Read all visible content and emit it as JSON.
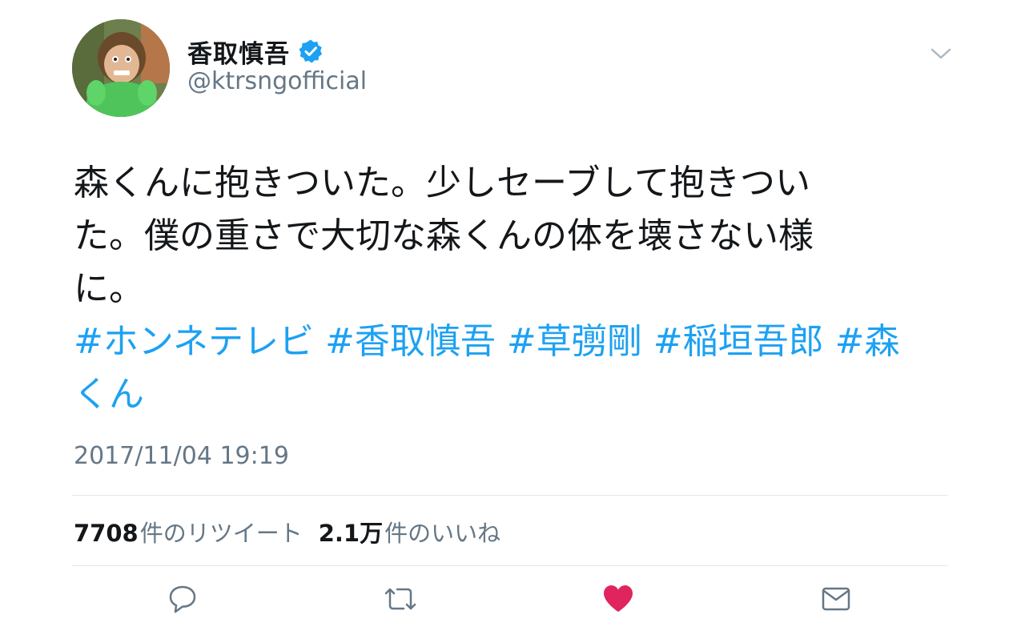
{
  "author": {
    "display_name": "香取慎吾",
    "handle": "@ktrsngofficial",
    "verified": true
  },
  "tweet": {
    "text": "森くんに抱きついた。少しセーブして抱きつい\nた。僕の重さで大切な森くんの体を壊さない様\nに。",
    "hashtags": [
      "#ホンネテレビ",
      "#香取慎吾",
      "#草彅剛",
      "#稲垣吾郎",
      "#森",
      "くん"
    ],
    "timestamp": "2017/11/04 19:19"
  },
  "stats": {
    "retweets_count": "7708",
    "retweets_label": "件のリツイート",
    "likes_count": "2.1万",
    "likes_label": "件のいいね"
  },
  "actions": {
    "reply_icon": "reply-icon",
    "retweet_icon": "retweet-icon",
    "like_icon": "heart-icon",
    "dm_icon": "envelope-icon"
  },
  "colors": {
    "link": "#1da1f2",
    "like": "#e0245e",
    "secondary_text": "#657786",
    "divider": "#e1e8ed"
  }
}
